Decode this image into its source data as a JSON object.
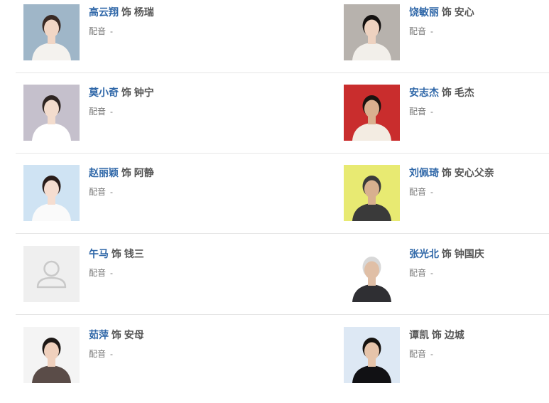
{
  "cast": [
    {
      "left": {
        "actor": "高云翔",
        "as": "饰",
        "role": "杨瑞",
        "dub_label": "配音",
        "dub_value": "-",
        "photo": {
          "bg": "#9fb6c8",
          "skin": "#f1d6c5",
          "hair": "#3a2a24",
          "cloth": "#f4f2ee"
        }
      },
      "right": {
        "actor": "饶敏丽",
        "as": "饰",
        "role": "安心",
        "dub_label": "配音",
        "dub_value": "-",
        "photo": {
          "bg": "#b7b2ad",
          "skin": "#eed2c0",
          "hair": "#141110",
          "cloth": "#f2efea"
        }
      }
    },
    {
      "left": {
        "actor": "莫小奇",
        "as": "饰",
        "role": "钟宁",
        "dub_label": "配音",
        "dub_value": "-",
        "photo": {
          "bg": "#c5c0cc",
          "skin": "#f3dccd",
          "hair": "#2e2522",
          "cloth": "#ffffff"
        }
      },
      "right": {
        "actor": "安志杰",
        "as": "饰",
        "role": "毛杰",
        "dub_label": "配音",
        "dub_value": "-",
        "photo": {
          "bg": "#c92d2d",
          "skin": "#d9b08f",
          "hair": "#1a1410",
          "cloth": "#f3ece2"
        }
      }
    },
    {
      "left": {
        "actor": "赵丽颖",
        "as": "饰",
        "role": "阿静",
        "dub_label": "配音",
        "dub_value": "-",
        "photo": {
          "bg": "#cfe3f3",
          "skin": "#f5ddd0",
          "hair": "#2a1d1a",
          "cloth": "#fafafa"
        }
      },
      "right": {
        "actor": "刘佩琦",
        "as": "饰",
        "role": "安心父亲",
        "dub_label": "配音",
        "dub_value": "-",
        "photo": {
          "bg": "#e8ea72",
          "skin": "#d8b08f",
          "hair": "#3b3b3b",
          "cloth": "#3a3a3a"
        }
      }
    },
    {
      "left": {
        "actor": "午马",
        "as": "饰",
        "role": "钱三",
        "dub_label": "配音",
        "dub_value": "-",
        "placeholder": true
      },
      "right": {
        "actor": "张光北",
        "as": "饰",
        "role": "钟国庆",
        "dub_label": "配音",
        "dub_value": "-",
        "photo": {
          "bg": "#ffffff",
          "skin": "#e0bfa6",
          "hair": "#d8d8d8",
          "cloth": "#2f2f33"
        }
      }
    },
    {
      "left": {
        "actor": "茹萍",
        "as": "饰",
        "role": "安母",
        "dub_label": "配音",
        "dub_value": "-",
        "photo": {
          "bg": "#f4f4f4",
          "skin": "#efd0bd",
          "hair": "#1d1816",
          "cloth": "#5a4c48"
        }
      },
      "right": {
        "actor": "谭凯",
        "as": "饰",
        "role": "边城",
        "dub_label": "配音",
        "dub_value": "-",
        "plain_actor": true,
        "photo": {
          "bg": "#dde8f4",
          "skin": "#e6c4aa",
          "hair": "#15120f",
          "cloth": "#111114"
        }
      }
    }
  ]
}
